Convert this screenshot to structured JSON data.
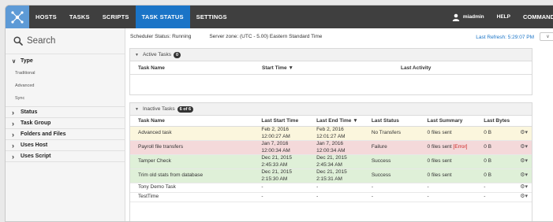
{
  "nav": {
    "items": [
      {
        "label": "HOSTS",
        "active": false
      },
      {
        "label": "TASKS",
        "active": false
      },
      {
        "label": "SCRIPTS",
        "active": false
      },
      {
        "label": "TASK STATUS",
        "active": true
      },
      {
        "label": "SETTINGS",
        "active": false
      }
    ],
    "user": "miadmin",
    "help": "HELP",
    "command": "COMMAND"
  },
  "sidebar": {
    "search_placeholder": "Search",
    "type_label": "Type",
    "type_options": [
      "Traditional",
      "Advanced",
      "Sync"
    ],
    "groups": [
      "Status",
      "Task Group",
      "Folders and Files",
      "Uses Host",
      "Uses Script"
    ]
  },
  "status": {
    "scheduler": "Scheduler Status: Running",
    "zone": "Server zone: (UTC - 5.00) Eastern Standard Time",
    "refresh": "Last Refresh: 5:29:07 PM"
  },
  "active": {
    "title": "Active Tasks",
    "count": "0",
    "columns": [
      "Task Name",
      "Start Time ▼",
      "Last Activity"
    ]
  },
  "inactive": {
    "title": "Inactive Tasks",
    "count": "6 of 6",
    "columns": [
      "Task Name",
      "Last Start Time",
      "Last End Time ▼",
      "Last Status",
      "Last Summary",
      "Last Bytes"
    ],
    "rows": [
      {
        "name": "Advanced task",
        "start": "Feb 2, 2016 12:00:27 AM",
        "end": "Feb 2, 2016 12:01:27 AM",
        "status": "No Transfers",
        "summary": "0 files sent",
        "error": "",
        "bytes": "0 B",
        "color": "#fbf6dd"
      },
      {
        "name": "Payroll file transfers",
        "start": "Jan 7, 2016 12:00:34 AM",
        "end": "Jan 7, 2016 12:00:34 AM",
        "status": "Failure",
        "summary": "0 files sent",
        "error": "[Error]",
        "bytes": "0 B",
        "color": "#f4d9da"
      },
      {
        "name": "Tamper Check",
        "start": "Dec 21, 2015 2:45:33 AM",
        "end": "Dec 21, 2015 2:45:34 AM",
        "status": "Success",
        "summary": "0 files sent",
        "error": "",
        "bytes": "0 B",
        "color": "#dff0d8"
      },
      {
        "name": "Trim old stats from database",
        "start": "Dec 21, 2015 2:15:30 AM",
        "end": "Dec 21, 2015 2:15:31 AM",
        "status": "Success",
        "summary": "0 files sent",
        "error": "",
        "bytes": "0 B",
        "color": "#dff0d8"
      },
      {
        "name": "Tony Demo Task",
        "start": "-",
        "end": "-",
        "status": "-",
        "summary": "-",
        "error": "",
        "bytes": "-",
        "color": "#ffffff"
      },
      {
        "name": "TestTime",
        "start": "-",
        "end": "-",
        "status": "-",
        "summary": "-",
        "error": "",
        "bytes": "-",
        "color": "#ffffff"
      }
    ]
  },
  "colors": {
    "nav_bg": "#3f3f3f",
    "nav_active": "#1a74c7",
    "logo_bg": "#5d9ad6",
    "link": "#1a74c7",
    "error": "#cc2222"
  }
}
